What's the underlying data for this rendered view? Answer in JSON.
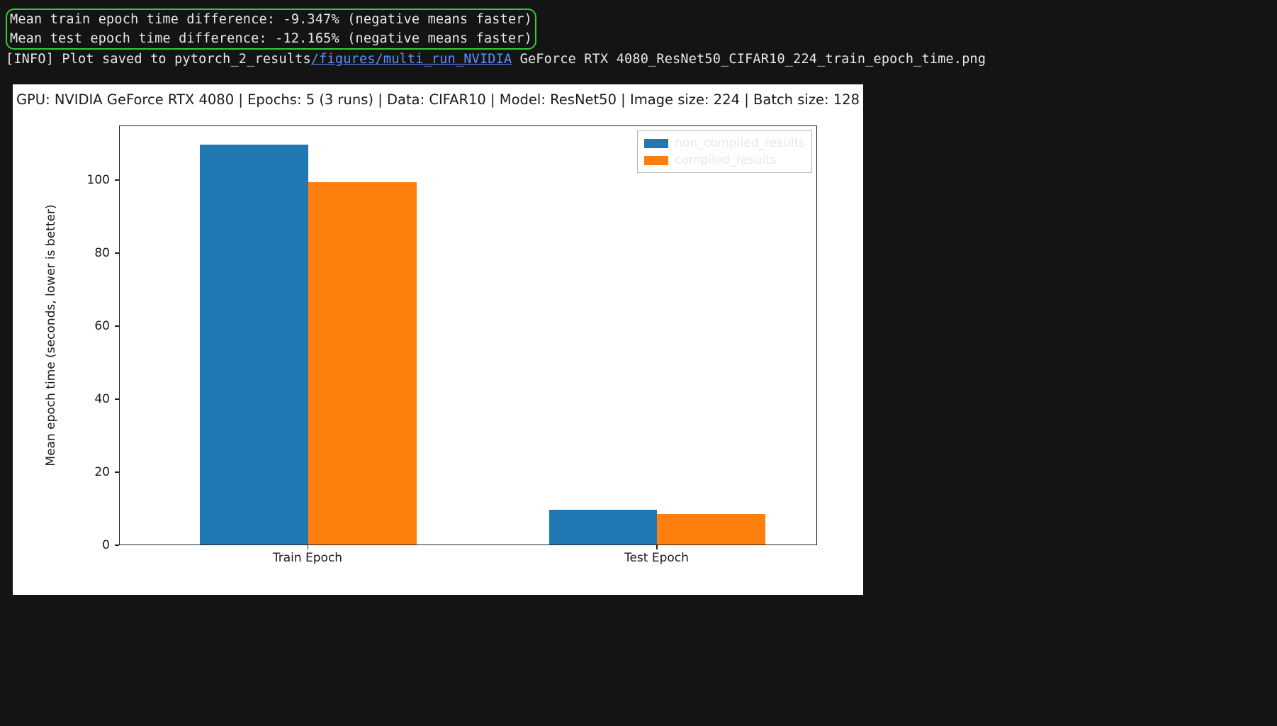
{
  "terminal": {
    "line1": "Mean train epoch time difference: -9.347% (negative means faster)",
    "line2": "Mean test epoch time difference: -12.165% (negative means faster)",
    "line3_prefix": "[INFO] Plot saved to pytorch_2_results",
    "line3_link": "/figures/multi_run_NVIDIA",
    "line3_suffix": " GeForce RTX 4080_ResNet50_CIFAR10_224_train_epoch_time.png"
  },
  "chart_data": {
    "type": "bar",
    "title": "GPU: NVIDIA GeForce RTX 4080 | Epochs: 5 (3 runs) | Data: CIFAR10 | Model: ResNet50 | Image size: 224 | Batch size: 128",
    "ylabel": "Mean epoch time (seconds, lower is better)",
    "categories": [
      "Train Epoch",
      "Test Epoch"
    ],
    "series": [
      {
        "name": "non_compiled_results",
        "color": "#1f77b4",
        "values": [
          109.5,
          9.5
        ]
      },
      {
        "name": "compiled_results",
        "color": "#ff7f0e",
        "values": [
          99.3,
          8.4
        ]
      }
    ],
    "yticks": [
      0,
      20,
      40,
      60,
      80,
      100
    ],
    "ylim": [
      0,
      115
    ]
  }
}
